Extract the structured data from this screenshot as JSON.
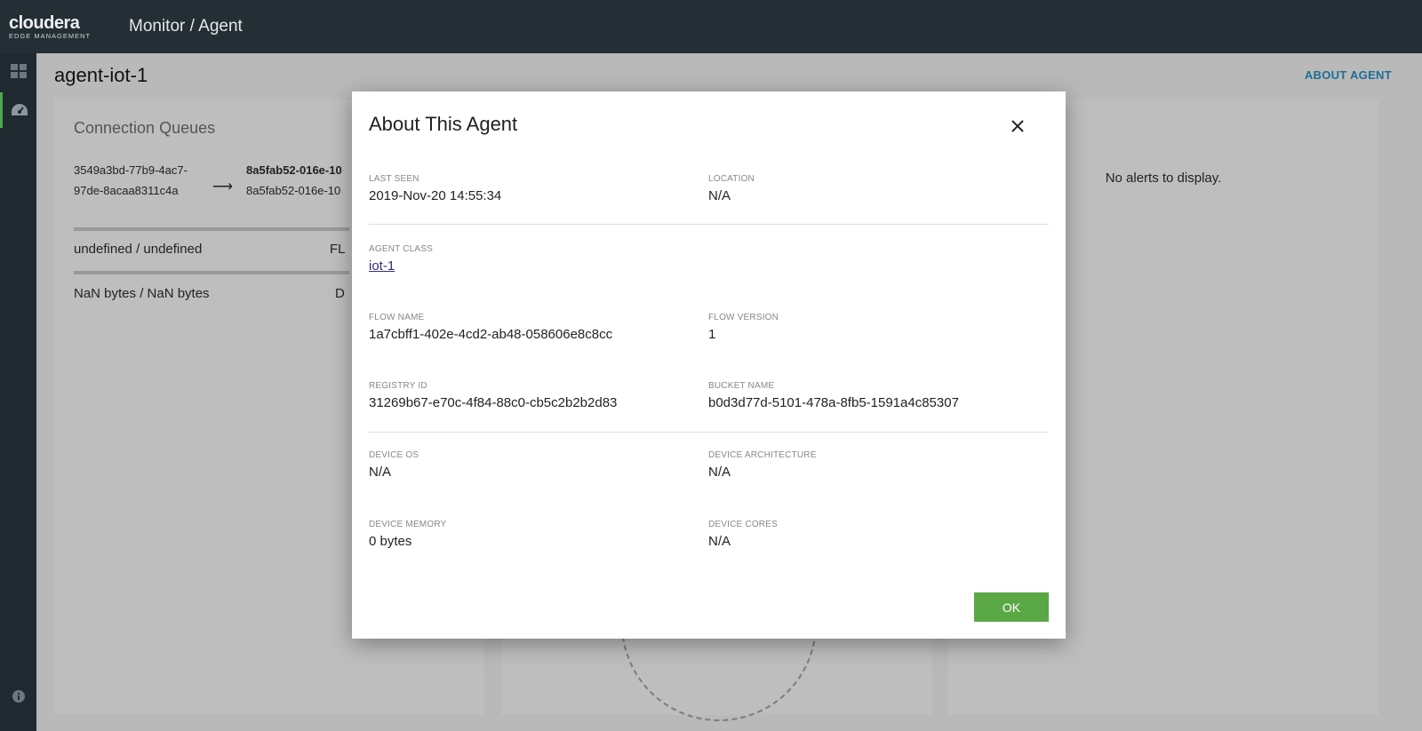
{
  "header": {
    "logo_main": "cloudera",
    "logo_sub": "EDGE MANAGEMENT",
    "breadcrumb": "Monitor / Agent"
  },
  "rail": {
    "icons": [
      "dashboard-grid-icon",
      "gauge-icon",
      "info-icon"
    ]
  },
  "page": {
    "title": "agent-iot-1",
    "about_link": "ABOUT AGENT"
  },
  "panels": {
    "connection_queues": {
      "title": "Connection Queues",
      "source_id": "3549a3bd-77b9-4ac7-97de-8acaa8311c4a",
      "dest_name": "8a5fab52-016e-10",
      "dest_id": "8a5fab52-016e-10",
      "flowfiles": "undefined / undefined",
      "flowfiles_right": "FL",
      "bytes": "NaN bytes / NaN bytes",
      "bytes_right": "D"
    },
    "alerts": {
      "empty_text": "No alerts to display."
    }
  },
  "modal": {
    "title": "About This Agent",
    "ok_label": "OK",
    "fields": {
      "last_seen": {
        "label": "LAST SEEN",
        "value": "2019-Nov-20 14:55:34"
      },
      "location": {
        "label": "LOCATION",
        "value": "N/A"
      },
      "agent_class": {
        "label": "AGENT CLASS",
        "value": "iot-1"
      },
      "flow_name": {
        "label": "FLOW NAME",
        "value": "1a7cbff1-402e-4cd2-ab48-058606e8c8cc"
      },
      "flow_version": {
        "label": "FLOW VERSION",
        "value": "1"
      },
      "registry_id": {
        "label": "REGISTRY ID",
        "value": "31269b67-e70c-4f84-88c0-cb5c2b2b2d83"
      },
      "bucket_name": {
        "label": "BUCKET NAME",
        "value": "b0d3d77d-5101-478a-8fb5-1591a4c85307"
      },
      "device_os": {
        "label": "DEVICE OS",
        "value": "N/A"
      },
      "device_arch": {
        "label": "DEVICE ARCHITECTURE",
        "value": "N/A"
      },
      "device_memory": {
        "label": "DEVICE MEMORY",
        "value": "0 bytes"
      },
      "device_cores": {
        "label": "DEVICE CORES",
        "value": "N/A"
      }
    }
  }
}
